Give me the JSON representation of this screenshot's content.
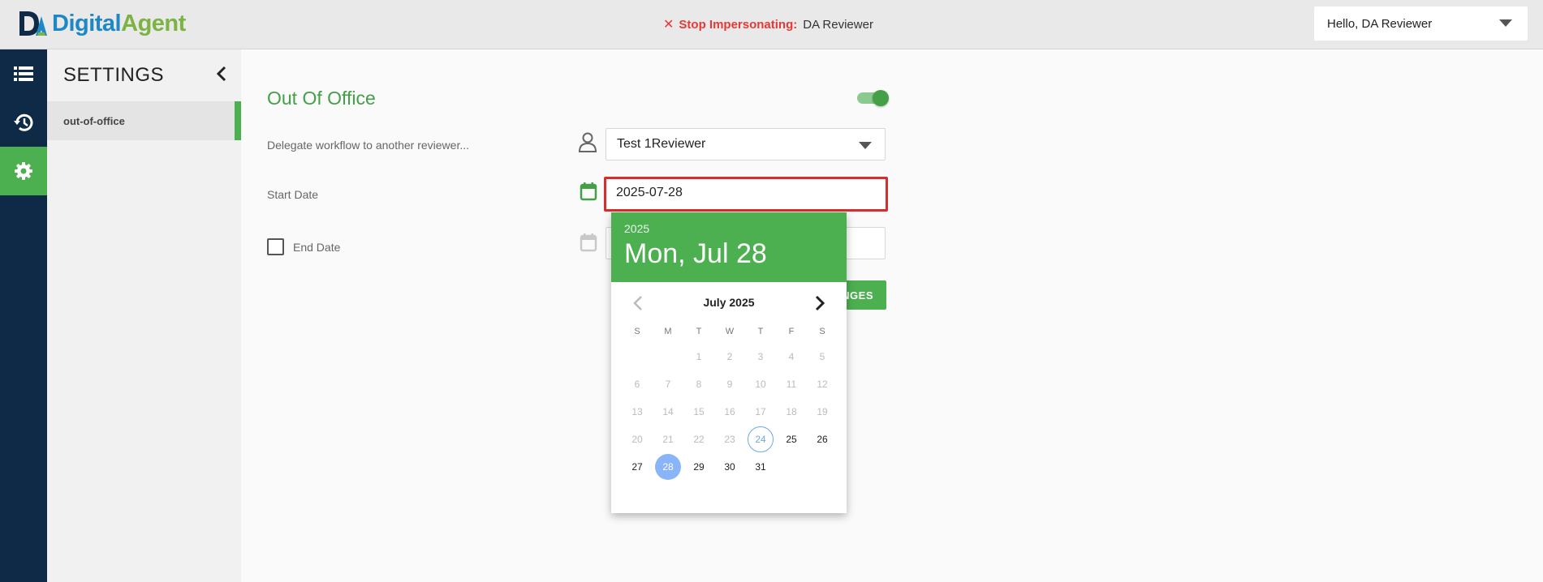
{
  "header": {
    "logo_digital": "Digital",
    "logo_agent": "Agent",
    "stop_impersonating_label": "Stop Impersonating:",
    "impersonated_user": "DA Reviewer",
    "user_greeting": "Hello,  DA Reviewer"
  },
  "rail": {
    "items": [
      {
        "icon": "list-icon"
      },
      {
        "icon": "history-icon"
      },
      {
        "icon": "gear-icon",
        "active": true
      }
    ]
  },
  "settings": {
    "title": "SETTINGS",
    "items": [
      {
        "label": "out-of-office"
      }
    ]
  },
  "form": {
    "title": "Out Of Office",
    "toggle_on": true,
    "delegate_label": "Delegate workflow to another reviewer...",
    "delegate_value": "Test 1Reviewer",
    "start_label": "Start Date",
    "start_value": "2025-07-28",
    "end_label": "End Date",
    "end_checked": false,
    "save_label": "NGES"
  },
  "datepicker": {
    "year": "2025",
    "selected_display": "Mon, Jul 28",
    "month_label": "July 2025",
    "weekdays": [
      "S",
      "M",
      "T",
      "W",
      "T",
      "F",
      "S"
    ],
    "first_weekday_index": 2,
    "days_in_month": 31,
    "today": 24,
    "selected": 28,
    "min_enabled": 24
  },
  "colors": {
    "brand_green": "#4caf50",
    "rail_navy": "#0e2a47",
    "focus_red": "#d32f2f",
    "selected_blue": "#8ab4f8"
  }
}
